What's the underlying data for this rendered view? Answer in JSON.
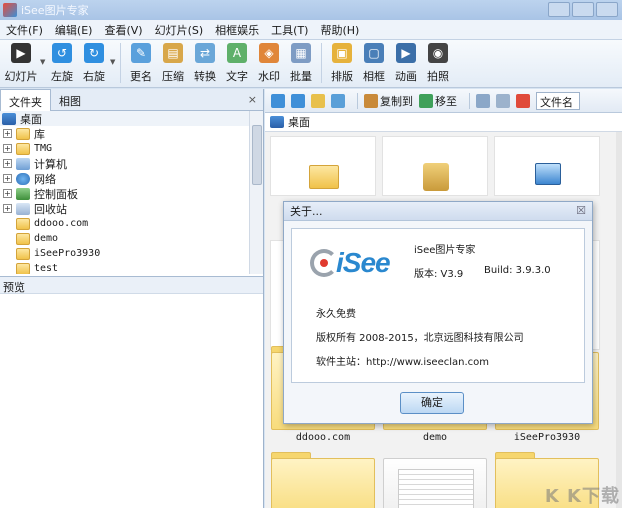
{
  "window": {
    "title": "iSee图片专家"
  },
  "menu": [
    "文件(F)",
    "编辑(E)",
    "查看(V)",
    "幻灯片(S)",
    "相框娱乐",
    "工具(T)",
    "帮助(H)"
  ],
  "toolbar": {
    "slideshow": "幻灯片",
    "rotate_left": "左旋",
    "rotate_right": "右旋",
    "rename": "更名",
    "compress": "压缩",
    "convert": "转换",
    "text": "文字",
    "watermark": "水印",
    "batch": "批量",
    "layout": "排版",
    "frame": "相框",
    "animation": "动画",
    "capture": "拍照"
  },
  "left": {
    "tabs": {
      "folder": "文件夹",
      "album": "相图"
    },
    "close": "×",
    "tree": {
      "root": "桌面",
      "items": [
        {
          "label": "库",
          "icon": "folder",
          "exp": "+"
        },
        {
          "label": "TMG",
          "icon": "folder",
          "exp": "+"
        },
        {
          "label": "计算机",
          "icon": "pc",
          "exp": "+"
        },
        {
          "label": "网络",
          "icon": "net",
          "exp": "+"
        },
        {
          "label": "控制面板",
          "icon": "cp",
          "exp": "+"
        },
        {
          "label": "回收站",
          "icon": "bin",
          "exp": "+"
        },
        {
          "label": "ddooo.com",
          "icon": "folder",
          "exp": ""
        },
        {
          "label": "demo",
          "icon": "folder",
          "exp": ""
        },
        {
          "label": "iSeePro3930",
          "icon": "folder",
          "exp": ""
        },
        {
          "label": "test",
          "icon": "folder",
          "exp": ""
        }
      ]
    },
    "preview_label": "预览"
  },
  "right_toolbar": {
    "copy_to": "复制到",
    "move_to": "移至",
    "filter": "文件名"
  },
  "path": {
    "label": "桌面"
  },
  "thumbs": {
    "cap1": "ddooo.com",
    "cap2": "demo",
    "cap3": "iSeePro3930"
  },
  "dialog": {
    "title": "关于...",
    "close": "☒",
    "logo": "iSee",
    "product": "iSee图片专家",
    "version": "版本: V3.9",
    "build": "Build: 3.9.3.0",
    "free": "永久免费",
    "copyright": "版权所有 2008-2015，北京远图科技有限公司",
    "site": "软件主站：http://www.iseeclan.com",
    "ok": "确定"
  },
  "watermark": "K K下载",
  "colors": {
    "accent": "#2a88cf",
    "folder": "#f0c24a",
    "logo_red": "#e03a2f"
  }
}
